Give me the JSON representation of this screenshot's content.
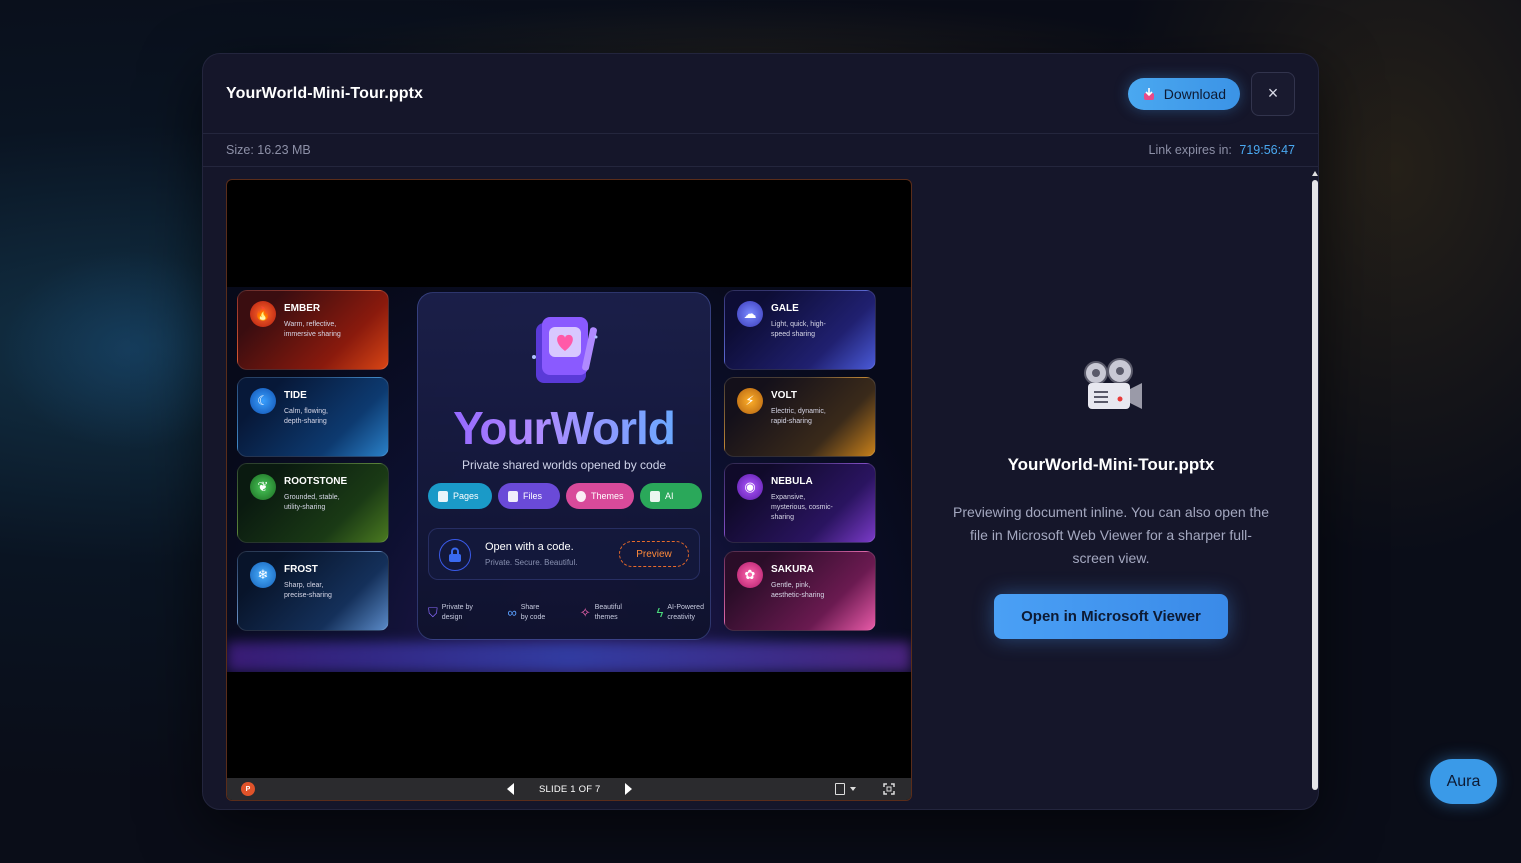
{
  "file": {
    "name": "YourWorld-Mini-Tour.pptx",
    "size_label": "Size: 16.23 MB",
    "expires_label": "Link expires in:",
    "expires_time": "719:56:47"
  },
  "header": {
    "download_label": "Download",
    "close_label": "×"
  },
  "viewer": {
    "slide_counter": "SLIDE 1 OF 7",
    "ppt_badge": "P"
  },
  "slide": {
    "brand": "YourWorld",
    "tagline": "Private shared worlds opened by code",
    "chips": [
      "Pages",
      "Files",
      "Themes",
      "AI"
    ],
    "open_code_title": "Open with a code.",
    "open_code_sub": "Private. Secure. Beautiful.",
    "preview_label": "Preview",
    "features": [
      {
        "line1": "Private by",
        "line2": "design"
      },
      {
        "line1": "Share",
        "line2": "by code"
      },
      {
        "line1": "Beautiful",
        "line2": "themes"
      },
      {
        "line1": "AI-Powered",
        "line2": "creativity"
      }
    ],
    "cards": [
      {
        "title": "EMBER",
        "desc": "Warm, reflective, immersive sharing"
      },
      {
        "title": "TIDE",
        "desc": "Calm, flowing, depth-sharing"
      },
      {
        "title": "ROOTSTONE",
        "desc": "Grounded, stable, utility-sharing"
      },
      {
        "title": "FROST",
        "desc": "Sharp, clear, precise-sharing"
      },
      {
        "title": "GALE",
        "desc": "Light, quick, high-speed sharing"
      },
      {
        "title": "VOLT",
        "desc": "Electric, dynamic, rapid-sharing"
      },
      {
        "title": "NEBULA",
        "desc": "Expansive, mysterious, cosmic-sharing"
      },
      {
        "title": "SAKURA",
        "desc": "Gentle, pink, aesthetic-sharing"
      }
    ]
  },
  "panel": {
    "title": "YourWorld-Mini-Tour.pptx",
    "description": "Previewing document inline. You can also open the file in Microsoft Web Viewer for a sharper full-screen view.",
    "open_button": "Open in Microsoft Viewer"
  },
  "assistant": {
    "label": "Aura"
  },
  "colors": {
    "accent": "#4aa8f0",
    "modal_bg": "#15162a",
    "expires_time": "#4aa8f0"
  }
}
